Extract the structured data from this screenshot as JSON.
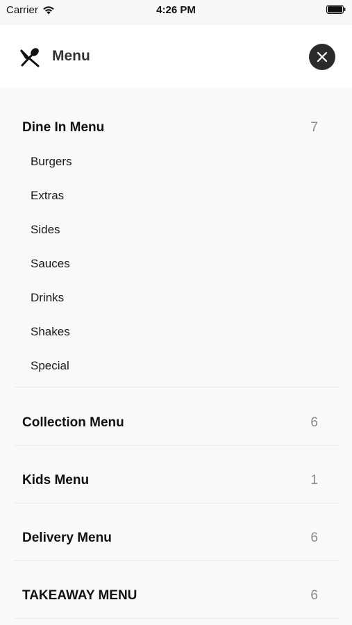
{
  "status_bar": {
    "carrier": "Carrier",
    "time": "4:26 PM"
  },
  "header": {
    "title": "Menu",
    "icon": "cutlery-icon",
    "close_icon": "close-icon"
  },
  "categories": [
    {
      "title": "Dine In Menu",
      "count": "7",
      "items": [
        "Burgers",
        "Extras",
        "Sides",
        "Sauces",
        "Drinks",
        "Shakes",
        "Special"
      ]
    },
    {
      "title": "Collection Menu",
      "count": "6"
    },
    {
      "title": "Kids Menu",
      "count": "1"
    },
    {
      "title": "Delivery Menu",
      "count": "6"
    },
    {
      "title": "TAKEAWAY MENU",
      "count": "6"
    }
  ],
  "colors": {
    "background": "#f9f9f9",
    "close_button": "#2b2b2b",
    "count_text": "#8a8a8a"
  }
}
